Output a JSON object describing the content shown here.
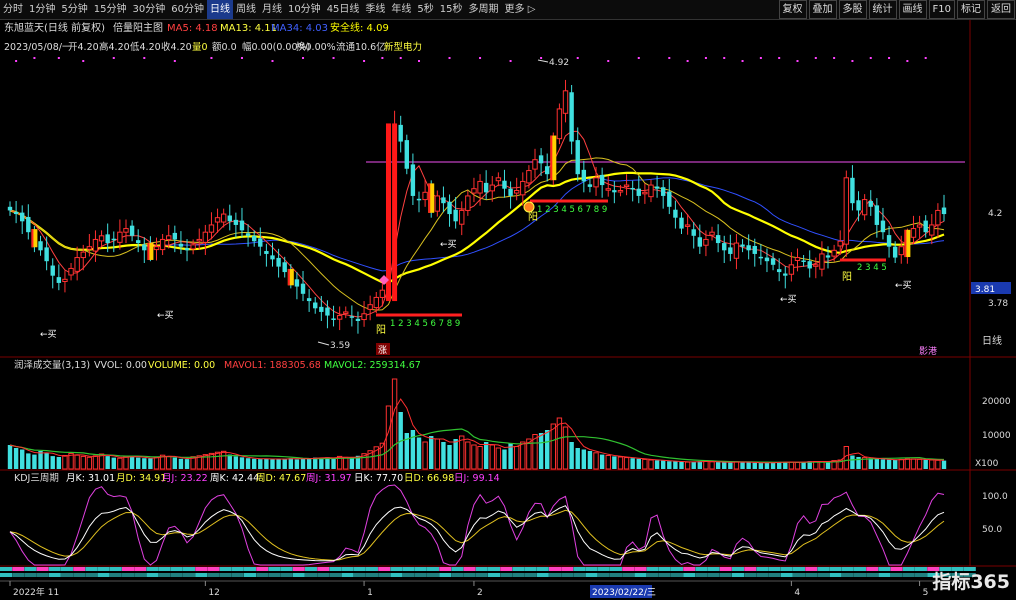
{
  "toolbar": {
    "periods": [
      "分时",
      "1分钟",
      "5分钟",
      "15分钟",
      "30分钟",
      "60分钟",
      "日线",
      "周线",
      "月线",
      "10分钟",
      "45日线",
      "季线",
      "年线",
      "5秒",
      "15秒",
      "多周期",
      "更多 ▷"
    ],
    "active_period": "日线",
    "buttons": [
      "复权",
      "叠加",
      "多股",
      "统计",
      "画线",
      "F10",
      "标记",
      "返回"
    ]
  },
  "chart_data": [
    {
      "type": "candlestick",
      "title": "东旭蓝天(日线 前复权)",
      "indicator_name": "倍量阳主图",
      "ma_labels": [
        {
          "text": "MA5: 4.18",
          "color": "#ff4040"
        },
        {
          "text": "MA13: 4.11",
          "color": "#ffff40"
        },
        {
          "text": "MA34: 4.03",
          "color": "#4060ff"
        },
        {
          "text": "安全线: 4.09",
          "color": "#ffff00"
        }
      ],
      "info_line": {
        "date": "2023/05/08/一",
        "open": "开4.20",
        "high": "高4.20",
        "low": "低4.20",
        "close": "收4.20",
        "volume": "量0",
        "amount": "额0.0",
        "change": "幅0.00(0.00%)",
        "turnover": "换0.00%",
        "float_cap": "流通10.6亿",
        "concept": "新型电力"
      },
      "ylim": [
        3.45,
        5.05
      ],
      "y_ticks": [
        4.2,
        3.78
      ],
      "price_tags": [
        {
          "text": "3.81",
          "value": 3.81
        }
      ],
      "annotations": {
        "high_label": "4.92",
        "low_label": "3.59",
        "buy": "←买",
        "yang": "阳",
        "zhang": "涨",
        "count_seq": "1 2 3 4 5 6 7 8 9",
        "count_short": "2 3 4 5",
        "brand": "影港"
      },
      "closes": [
        4.22,
        4.2,
        4.16,
        4.1,
        4.05,
        4.0,
        3.94,
        3.86,
        3.82,
        3.84,
        3.9,
        3.96,
        3.99,
        4.02,
        4.06,
        4.08,
        4.04,
        4.06,
        4.1,
        4.12,
        4.08,
        4.04,
        4.0,
        3.98,
        4.02,
        4.06,
        4.08,
        4.06,
        4.02,
        4.0,
        4.03,
        4.06,
        4.1,
        4.14,
        4.18,
        4.2,
        4.16,
        4.14,
        4.11,
        4.08,
        4.05,
        4.02,
        3.98,
        3.95,
        3.91,
        3.88,
        3.84,
        3.8,
        3.76,
        3.72,
        3.68,
        3.66,
        3.64,
        3.62,
        3.64,
        3.66,
        3.63,
        3.61,
        3.65,
        3.7,
        3.74,
        3.78,
        4.1,
        4.7,
        4.6,
        4.45,
        4.3,
        4.28,
        4.32,
        4.24,
        4.3,
        4.26,
        4.2,
        4.16,
        4.22,
        4.3,
        4.34,
        4.38,
        4.32,
        4.36,
        4.4,
        4.34,
        4.3,
        4.33,
        4.38,
        4.44,
        4.5,
        4.48,
        4.42,
        4.6,
        4.78,
        4.88,
        4.6,
        4.42,
        4.38,
        4.35,
        4.4,
        4.36,
        4.34,
        4.32,
        4.33,
        4.36,
        4.34,
        4.3,
        4.32,
        4.36,
        4.34,
        4.3,
        4.24,
        4.18,
        4.12,
        4.14,
        4.08,
        4.02,
        4.06,
        4.1,
        4.04,
        4.0,
        3.98,
        4.04,
        4.02,
        4.0,
        3.98,
        3.96,
        3.94,
        3.92,
        3.88,
        3.86,
        3.92,
        3.96,
        3.94,
        3.9,
        3.92,
        3.98,
        3.96,
        4.0,
        4.05,
        4.4,
        4.26,
        4.22,
        4.28,
        4.24,
        4.14,
        4.1,
        4.02,
        3.96,
        4.02,
        4.08,
        4.12,
        4.14,
        4.1,
        4.14,
        4.22,
        4.2
      ],
      "mid_volume_panel": {
        "name": "润泽成交量(3,13)",
        "vvol": "VVOL: 0.00",
        "volume": "VOLUME: 0.00",
        "mavol1": "MAVOL1: 188305.68",
        "mavol2": "MAVOL2: 259314.67",
        "y_ticks": [
          "20000",
          "10000"
        ],
        "unit": "X100",
        "ylim": [
          0,
          33000
        ],
        "values": [
          8000,
          7000,
          6500,
          5200,
          4800,
          6000,
          5400,
          4300,
          4000,
          4500,
          5200,
          4600,
          4200,
          3900,
          4400,
          5000,
          4300,
          3800,
          3600,
          4200,
          4400,
          3800,
          3600,
          3500,
          4000,
          4600,
          4200,
          3800,
          3400,
          3300,
          4100,
          4400,
          4800,
          5200,
          5600,
          5900,
          4800,
          4200,
          3900,
          3600,
          3400,
          3300,
          3500,
          3200,
          3300,
          3400,
          3600,
          3200,
          3400,
          3600,
          3800,
          3700,
          3900,
          3500,
          4200,
          3900,
          3600,
          4400,
          5100,
          6100,
          7400,
          8600,
          21000,
          30000,
          19000,
          12000,
          13000,
          10500,
          9000,
          11000,
          10000,
          9000,
          8000,
          10000,
          11000,
          9000,
          8000,
          7500,
          9000,
          8000,
          7000,
          6500,
          8500,
          7500,
          9000,
          10000,
          11500,
          12000,
          13000,
          15000,
          17000,
          14000,
          9000,
          7000,
          6500,
          6000,
          5400,
          4800,
          4500,
          4200,
          4000,
          3800,
          3600,
          3400,
          3200,
          3000,
          2900,
          2800,
          2600,
          2500,
          2400,
          2300,
          2400,
          2600,
          2500,
          2400,
          2300,
          2200,
          2300,
          2400,
          2300,
          2200,
          2100,
          2000,
          2100,
          2200,
          2300,
          2400,
          2300,
          2200,
          2400,
          2600,
          2500,
          2400,
          2600,
          2800,
          3000,
          7500,
          4500,
          4000,
          3800,
          3600,
          3400,
          3200,
          3100,
          3000,
          3200,
          3400,
          3300,
          3200,
          3100,
          3000,
          2900,
          2800
        ]
      },
      "kdj_panel": {
        "name": "KDJ三周期",
        "labels": [
          {
            "text": "月K: 31.01",
            "color": "#ffffff"
          },
          {
            "text": "月D: 34.91",
            "color": "#ffff40"
          },
          {
            "text": "月J: 23.22",
            "color": "#ff40ff"
          },
          {
            "text": "周K: 42.44",
            "color": "#ffffff"
          },
          {
            "text": "周D: 47.67",
            "color": "#ffff40"
          },
          {
            "text": "周J: 31.97",
            "color": "#ff40ff"
          },
          {
            "text": "日K: 77.70",
            "color": "#ffffff"
          },
          {
            "text": "日D: 66.98",
            "color": "#ffff40"
          },
          {
            "text": "日J: 99.14",
            "color": "#ff40ff"
          }
        ],
        "y_ticks": [
          "100.0",
          "50.0"
        ],
        "ylim": [
          0,
          120
        ]
      },
      "x_labels": [
        {
          "text": "2022年 11",
          "bar": 0
        },
        {
          "text": "12",
          "bar": 32
        },
        {
          "text": "1",
          "bar": 58
        },
        {
          "text": "2",
          "bar": 76
        },
        {
          "text": "4",
          "bar": 128
        },
        {
          "text": "5",
          "bar": 149
        }
      ],
      "cursor_date": "2023/02/22/三",
      "right_labels": {
        "period": "日线"
      }
    }
  ],
  "brand_logo": "指标365"
}
